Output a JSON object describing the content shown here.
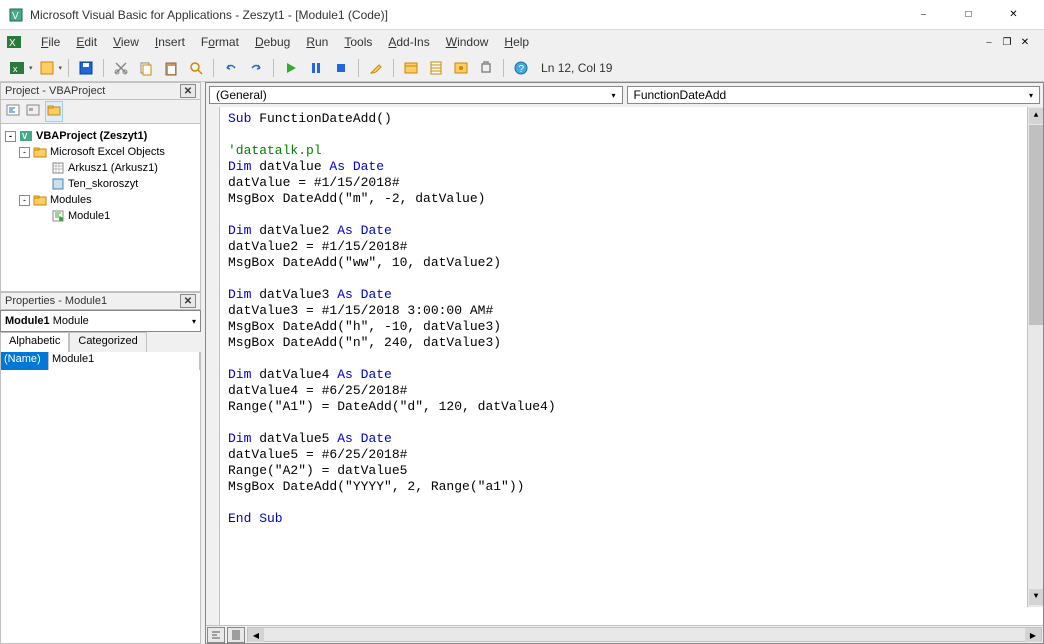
{
  "titlebar": {
    "title": "Microsoft Visual Basic for Applications - Zeszyt1 - [Module1 (Code)]"
  },
  "menus": {
    "file": "File",
    "edit": "Edit",
    "view": "View",
    "insert": "Insert",
    "format": "Format",
    "debug": "Debug",
    "run": "Run",
    "tools": "Tools",
    "addins": "Add-Ins",
    "window": "Window",
    "help": "Help"
  },
  "toolbar": {
    "status": "Ln 12, Col 19"
  },
  "project": {
    "title": "Project - VBAProject",
    "root": "VBAProject (Zeszyt1)",
    "node_excel": "Microsoft Excel Objects",
    "sheet1": "Arkusz1 (Arkusz1)",
    "workbook": "Ten_skoroszyt",
    "node_modules": "Modules",
    "module1": "Module1"
  },
  "properties": {
    "title": "Properties - Module1",
    "objName": "Module1",
    "objType": "Module",
    "tab1": "Alphabetic",
    "tab2": "Categorized",
    "propName": "(Name)",
    "propValue": "Module1"
  },
  "code_dropdowns": {
    "left": "(General)",
    "right": "FunctionDateAdd"
  },
  "code": {
    "l1": {
      "a": "Sub",
      "b": " FunctionDateAdd()"
    },
    "l2": "",
    "l3": "'datatalk.pl",
    "l4": {
      "a": "Dim",
      "b": " datValue ",
      "c": "As Date"
    },
    "l5": "datValue = #1/15/2018#",
    "l6": "MsgBox DateAdd(\"m\", -2, datValue)",
    "l7": "",
    "l8": {
      "a": "Dim",
      "b": " datValue2 ",
      "c": "As Date"
    },
    "l9": "datValue2 = #1/15/2018#",
    "l10": "MsgBox DateAdd(\"ww\", 10, datValue2)",
    "l11": "",
    "l12": {
      "a": "Dim",
      "b": " datValue3 ",
      "c": "As Date"
    },
    "l13": "datValue3 = #1/15/2018 3:00:00 AM#",
    "l14": "MsgBox DateAdd(\"h\", -10, datValue3)",
    "l15": "MsgBox DateAdd(\"n\", 240, datValue3)",
    "l16": "",
    "l17": {
      "a": "Dim",
      "b": " datValue4 ",
      "c": "As Date"
    },
    "l18": "datValue4 = #6/25/2018#",
    "l19": "Range(\"A1\") = DateAdd(\"d\", 120, datValue4)",
    "l20": "",
    "l21": {
      "a": "Dim",
      "b": " datValue5 ",
      "c": "As Date"
    },
    "l22": "datValue5 = #6/25/2018#",
    "l23": "Range(\"A2\") = datValue5",
    "l24": "MsgBox DateAdd(\"YYYY\", 2, Range(\"a1\"))",
    "l25": "",
    "l26": "End Sub"
  }
}
